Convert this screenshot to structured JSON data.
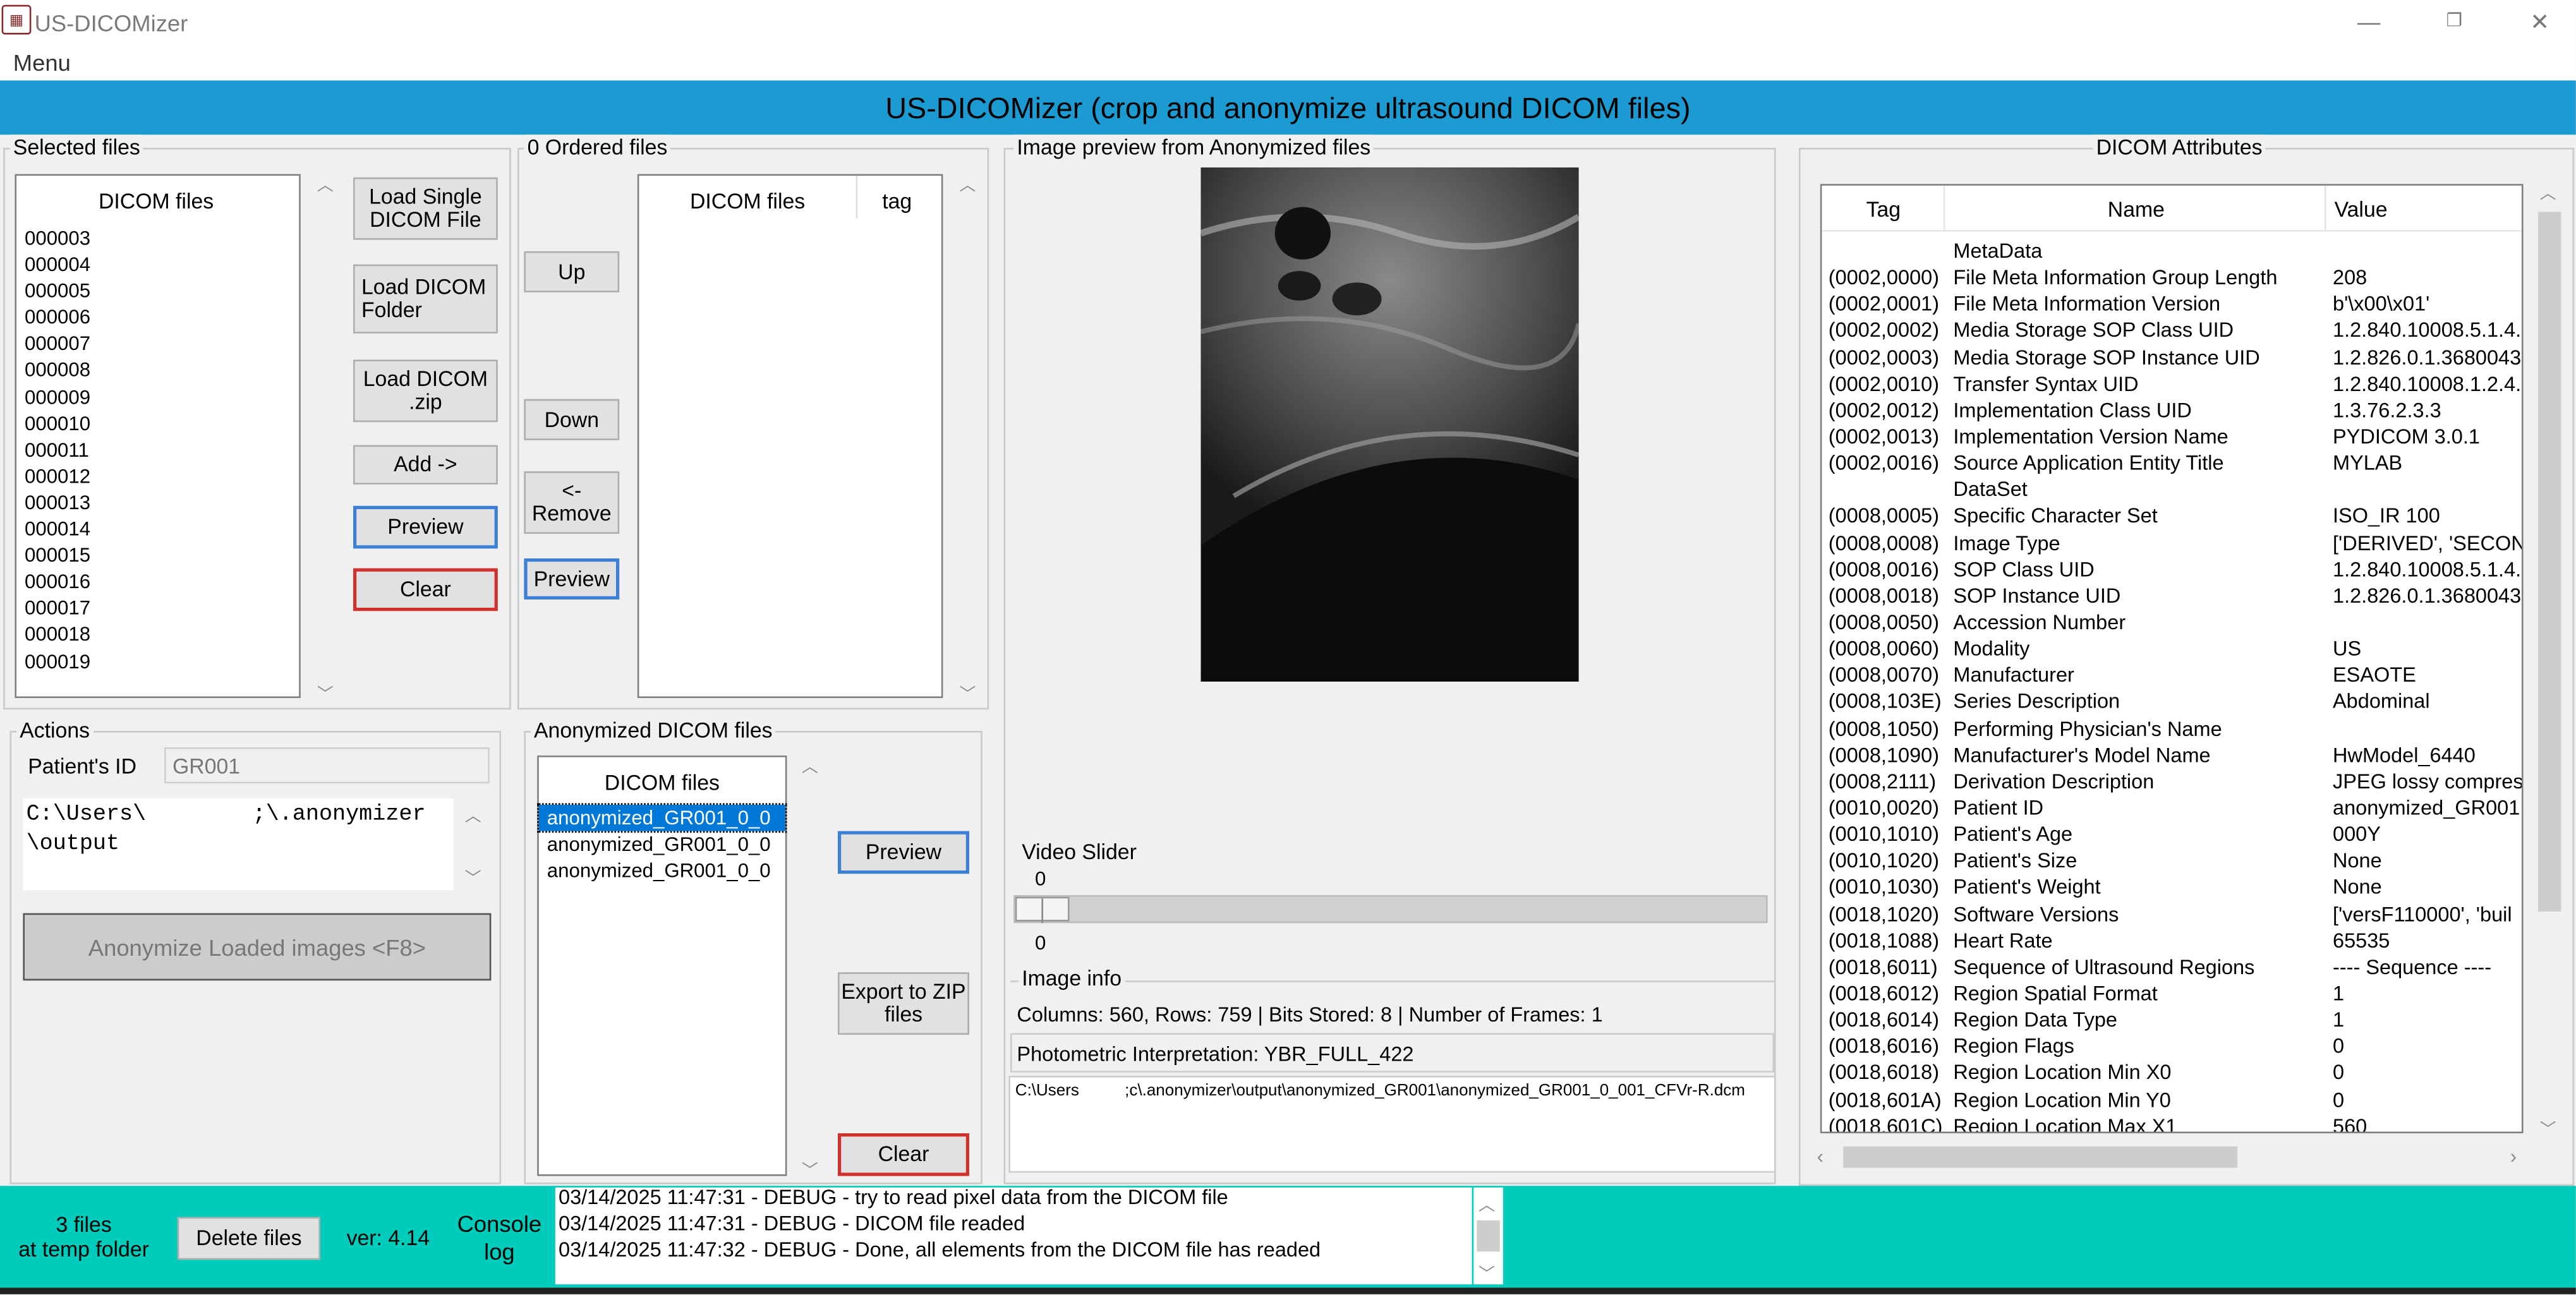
{
  "window": {
    "title": "US-DICOMizer",
    "minimize": "—",
    "restore": "❐",
    "close": "✕",
    "menu": "Menu"
  },
  "header": {
    "title": "US-DICOMizer (crop and anonymize ultrasound DICOM files)"
  },
  "selected": {
    "label": "Selected files",
    "column": "DICOM files",
    "files": [
      "000003",
      "000004",
      "000005",
      "000006",
      "000007",
      "000008",
      "000009",
      "000010",
      "000011",
      "000012",
      "000013",
      "000014",
      "000015",
      "000016",
      "000017",
      "000018",
      "000019"
    ],
    "buttons": {
      "load_single": "Load Single DICOM File",
      "load_folder": "Load DICOM Folder",
      "load_zip": "Load DICOM .zip",
      "add": "Add ->",
      "preview": "Preview",
      "clear": "Clear"
    }
  },
  "ordered": {
    "label": "0 Ordered files",
    "col_files": "DICOM files",
    "col_tag": "tag",
    "buttons": {
      "up": "Up",
      "down": "Down",
      "remove": "<- Remove",
      "preview": "Preview"
    }
  },
  "actions": {
    "label": "Actions",
    "patient_id_label": "Patient's ID",
    "patient_id": "GR001",
    "output_path": "C:\\Users\\        ;\\.anonymizer\\output",
    "anonymize_button": "Anonymize Loaded images <F8>"
  },
  "anonymized": {
    "label": "Anonymized DICOM files",
    "column": "DICOM files",
    "files": [
      "anonymized_GR001_0_0",
      "anonymized_GR001_0_0",
      "anonymized_GR001_0_0"
    ],
    "buttons": {
      "preview": "Preview",
      "export": "Export to ZIP files",
      "clear": "Clear"
    }
  },
  "preview": {
    "label": "Image preview from Anonymized files",
    "slider_label": "Video Slider",
    "slider_value": "0",
    "slider_min": "0",
    "slider_position": 0,
    "image_info_label": "Image info",
    "info_line1": "Columns: 560, Rows: 759  |  Bits Stored: 8  |  Number of Frames: 1",
    "info_line2": "Photometric Interpretation: YBR_FULL_422",
    "file_path": "C:\\Users          ;c\\.anonymizer\\output\\anonymized_GR001\\anonymized_GR001_0_001_CFVr-R.dcm"
  },
  "attributes": {
    "label": "DICOM Attributes",
    "col_tag": "Tag",
    "col_name": "Name",
    "col_value": "Value",
    "rows": [
      {
        "tag": "",
        "name": "MetaData",
        "value": ""
      },
      {
        "tag": "(0002,0000)",
        "name": "File Meta Information Group Length",
        "value": "208"
      },
      {
        "tag": "(0002,0001)",
        "name": "File Meta Information Version",
        "value": "b'\\x00\\x01'"
      },
      {
        "tag": "(0002,0002)",
        "name": "Media Storage SOP Class UID",
        "value": "1.2.840.10008.5.1.4."
      },
      {
        "tag": "(0002,0003)",
        "name": "Media Storage SOP Instance UID",
        "value": "1.2.826.0.1.3680043"
      },
      {
        "tag": "(0002,0010)",
        "name": "Transfer Syntax UID",
        "value": "1.2.840.10008.1.2.4."
      },
      {
        "tag": "(0002,0012)",
        "name": "Implementation Class UID",
        "value": "1.3.76.2.3.3"
      },
      {
        "tag": "(0002,0013)",
        "name": "Implementation Version Name",
        "value": "PYDICOM 3.0.1"
      },
      {
        "tag": "(0002,0016)",
        "name": "Source Application Entity Title",
        "value": "MYLAB"
      },
      {
        "tag": "",
        "name": "DataSet",
        "value": ""
      },
      {
        "tag": "(0008,0005)",
        "name": "Specific Character Set",
        "value": "ISO_IR 100"
      },
      {
        "tag": "(0008,0008)",
        "name": "Image Type",
        "value": "['DERIVED', 'SECON"
      },
      {
        "tag": "(0008,0016)",
        "name": "SOP Class UID",
        "value": "1.2.840.10008.5.1.4."
      },
      {
        "tag": "(0008,0018)",
        "name": "SOP Instance UID",
        "value": "1.2.826.0.1.3680043"
      },
      {
        "tag": "(0008,0050)",
        "name": "Accession Number",
        "value": ""
      },
      {
        "tag": "(0008,0060)",
        "name": "Modality",
        "value": "US"
      },
      {
        "tag": "(0008,0070)",
        "name": "Manufacturer",
        "value": "ESAOTE"
      },
      {
        "tag": "(0008,103E)",
        "name": "Series Description",
        "value": "Abdominal"
      },
      {
        "tag": "(0008,1050)",
        "name": "Performing Physician's Name",
        "value": ""
      },
      {
        "tag": "(0008,1090)",
        "name": "Manufacturer's Model Name",
        "value": "HwModel_6440"
      },
      {
        "tag": "(0008,2111)",
        "name": "Derivation Description",
        "value": "JPEG lossy compres"
      },
      {
        "tag": "(0010,0020)",
        "name": "Patient ID",
        "value": "anonymized_GR001"
      },
      {
        "tag": "(0010,1010)",
        "name": "Patient's Age",
        "value": "000Y"
      },
      {
        "tag": "(0010,1020)",
        "name": "Patient's Size",
        "value": "None"
      },
      {
        "tag": "(0010,1030)",
        "name": "Patient's Weight",
        "value": "None"
      },
      {
        "tag": "(0018,1020)",
        "name": "Software Versions",
        "value": "['versF110000', 'buil"
      },
      {
        "tag": "(0018,1088)",
        "name": "Heart Rate",
        "value": "65535"
      },
      {
        "tag": "(0018,6011)",
        "name": "Sequence of Ultrasound Regions",
        "value": "---- Sequence ----"
      },
      {
        "tag": "(0018,6012)",
        "name": "Region Spatial Format",
        "value": "1"
      },
      {
        "tag": "(0018,6014)",
        "name": "Region Data Type",
        "value": "1"
      },
      {
        "tag": "(0018,6016)",
        "name": "Region Flags",
        "value": "0"
      },
      {
        "tag": "(0018,6018)",
        "name": "Region Location Min X0",
        "value": "0"
      },
      {
        "tag": "(0018,601A)",
        "name": "Region Location Min Y0",
        "value": "0"
      },
      {
        "tag": "(0018,601C)",
        "name": "Region Location Max X1",
        "value": "560"
      }
    ]
  },
  "footer": {
    "temp_count": "3 files",
    "temp_label": "at temp folder",
    "delete_button": "Delete files",
    "version": "ver: 4.14",
    "console_label": "Console log",
    "log_lines": [
      "03/14/2025 11:47:31 - DEBUG - try to read pixel data from the DICOM file",
      "03/14/2025 11:47:31 - DEBUG - DICOM file readed",
      "03/14/2025 11:47:32 - DEBUG - Done, all elements from the DICOM file has readed"
    ]
  },
  "colors": {
    "header": "#1b9bd1",
    "footer": "#00ccbb",
    "focus_border": "#3b7fd6",
    "clear_border": "#d0312d"
  }
}
